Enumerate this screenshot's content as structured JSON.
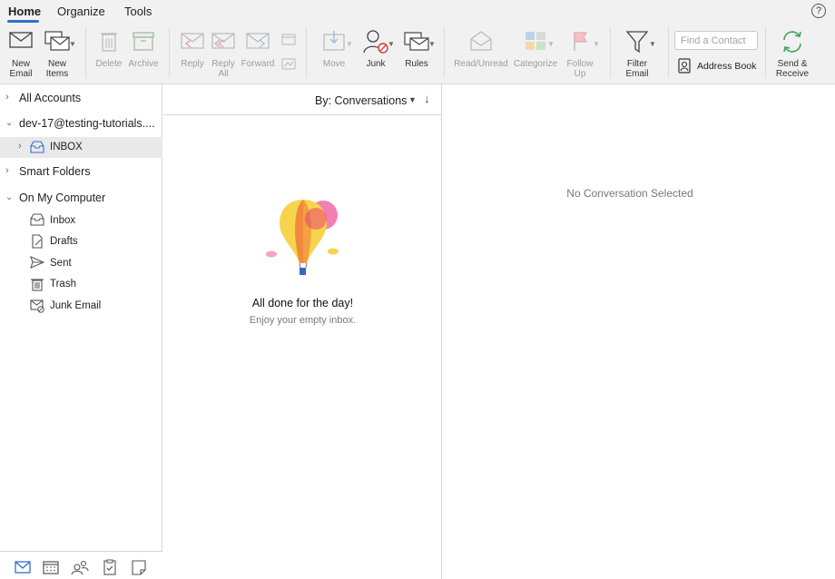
{
  "ribbon": {
    "tabs": [
      "Home",
      "Organize",
      "Tools"
    ],
    "help": "?"
  },
  "toolbar": {
    "new_email": [
      "New",
      "Email"
    ],
    "new_items": [
      "New",
      "Items"
    ],
    "delete": "Delete",
    "archive": "Archive",
    "reply": "Reply",
    "reply_all": [
      "Reply",
      "All"
    ],
    "forward": "Forward",
    "move": "Move",
    "junk": "Junk",
    "rules": "Rules",
    "read_unread": "Read/Unread",
    "categorize": "Categorize",
    "follow_up": [
      "Follow",
      "Up"
    ],
    "filter_email": [
      "Filter",
      "Email"
    ],
    "find_contact_placeholder": "Find a Contact",
    "address_book": "Address Book",
    "send_receive": [
      "Send &",
      "Receive"
    ]
  },
  "sidebar": {
    "all_accounts": "All Accounts",
    "account": "dev-17@testing-tutorials....",
    "inbox": "INBOX",
    "smart_folders": "Smart Folders",
    "on_my_computer": "On My Computer",
    "folders": [
      "Inbox",
      "Drafts",
      "Sent",
      "Trash",
      "Junk Email"
    ]
  },
  "list": {
    "sort_label": "By: Conversations",
    "empty_title": "All done for the day!",
    "empty_subtitle": "Enjoy your empty inbox."
  },
  "reading": {
    "empty": "No Conversation Selected"
  },
  "colors": {
    "accent": "#2f6fd0",
    "selection": "#e9e9e9",
    "balloon_yellow": "#f8d44c",
    "balloon_orange": "#f08a3e",
    "balloon_pink": "#f06aa6",
    "send_receive_green": "#3aa35c"
  }
}
